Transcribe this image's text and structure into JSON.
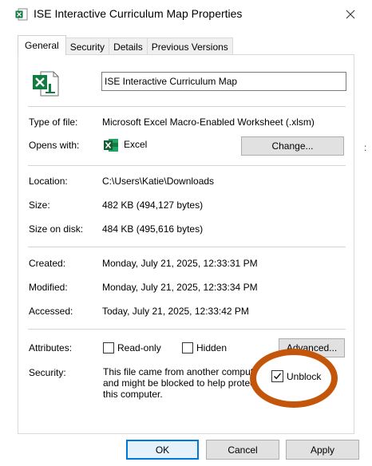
{
  "window": {
    "title": "ISE Interactive Curriculum Map Properties",
    "close_glyph": "✕"
  },
  "tabs": [
    {
      "label": "General",
      "active": true
    },
    {
      "label": "Security",
      "active": false
    },
    {
      "label": "Details",
      "active": false
    },
    {
      "label": "Previous Versions",
      "active": false
    }
  ],
  "file": {
    "name": "ISE Interactive Curriculum Map",
    "icon": "excel-file-icon"
  },
  "info": {
    "type_label": "Type of file:",
    "type_value": "Microsoft Excel Macro-Enabled Worksheet (.xlsm)",
    "opens_label": "Opens with:",
    "opens_app": "Excel",
    "change_label": "Change...",
    "location_label": "Location:",
    "location_value": "C:\\Users\\Katie\\Downloads",
    "size_label": "Size:",
    "size_value": "482 KB (494,127 bytes)",
    "size_disk_label": "Size on disk:",
    "size_disk_value": "484 KB (495,616 bytes)",
    "created_label": "Created:",
    "created_value": "Monday, July 21, 2025, 12:33:31 PM",
    "modified_label": "Modified:",
    "modified_value": "Monday, July 21, 2025, 12:33:34 PM",
    "accessed_label": "Accessed:",
    "accessed_value": "Today, July 21, 2025, 12:33:42 PM"
  },
  "attributes": {
    "label": "Attributes:",
    "readonly": {
      "label": "Read-only",
      "checked": false
    },
    "hidden": {
      "label": "Hidden",
      "checked": false
    },
    "advanced_label": "Advanced..."
  },
  "security": {
    "label": "Security:",
    "text": "This file came from another computer and might be blocked to help protect this computer.",
    "unblock": {
      "label": "Unblock",
      "checked": true
    }
  },
  "buttons": {
    "ok": "OK",
    "cancel": "Cancel",
    "apply": "Apply"
  },
  "colors": {
    "highlight": "#c4560b",
    "excel_green": "#107c41",
    "ok_border": "#0078d7"
  }
}
